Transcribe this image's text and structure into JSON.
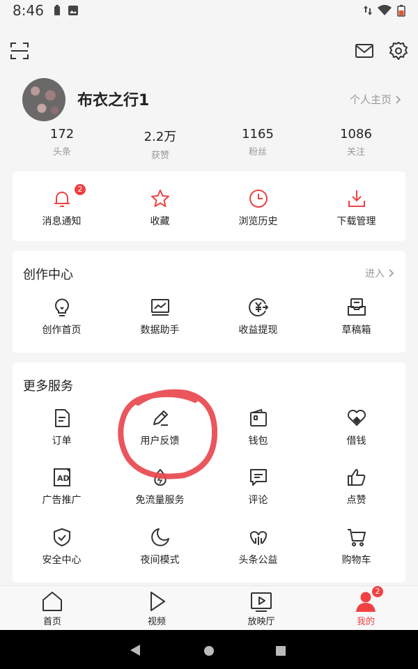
{
  "status_bar": {
    "time": "8:46"
  },
  "profile": {
    "username": "布衣之行1",
    "homepage_label": "个人主页"
  },
  "stats": [
    {
      "value": "172",
      "label": "头条"
    },
    {
      "value": "2.2万",
      "label": "获赞"
    },
    {
      "value": "1165",
      "label": "粉丝"
    },
    {
      "value": "1086",
      "label": "关注"
    }
  ],
  "quick_actions": [
    {
      "label": "消息通知",
      "icon": "bell-icon",
      "badge": "2"
    },
    {
      "label": "收藏",
      "icon": "star-icon"
    },
    {
      "label": "浏览历史",
      "icon": "clock-icon"
    },
    {
      "label": "下载管理",
      "icon": "download-icon"
    }
  ],
  "creation_center": {
    "title": "创作中心",
    "enter_label": "进入",
    "items": [
      {
        "label": "创作首页",
        "icon": "lightbulb-icon"
      },
      {
        "label": "数据助手",
        "icon": "chart-monitor-icon"
      },
      {
        "label": "收益提现",
        "icon": "yuan-coin-icon"
      },
      {
        "label": "草稿箱",
        "icon": "draft-box-icon"
      }
    ]
  },
  "more_services": {
    "title": "更多服务",
    "items": [
      {
        "label": "订单",
        "icon": "document-icon"
      },
      {
        "label": "用户反馈",
        "icon": "pen-icon"
      },
      {
        "label": "钱包",
        "icon": "wallet-icon"
      },
      {
        "label": "借钱",
        "icon": "loan-heart-icon"
      },
      {
        "label": "广告推广",
        "icon": "ad-icon"
      },
      {
        "label": "免流量服务",
        "icon": "data-drop-icon"
      },
      {
        "label": "评论",
        "icon": "comment-icon"
      },
      {
        "label": "点赞",
        "icon": "thumbs-up-icon"
      },
      {
        "label": "安全中心",
        "icon": "shield-icon"
      },
      {
        "label": "夜间模式",
        "icon": "moon-icon"
      },
      {
        "label": "头条公益",
        "icon": "charity-icon"
      },
      {
        "label": "购物车",
        "icon": "cart-icon"
      }
    ]
  },
  "tabbar": {
    "tabs": [
      {
        "label": "首页",
        "icon": "home-icon"
      },
      {
        "label": "视频",
        "icon": "play-icon"
      },
      {
        "label": "放映厅",
        "icon": "tv-icon"
      },
      {
        "label": "我的",
        "icon": "person-icon",
        "badge": "2",
        "active": true
      }
    ]
  },
  "colors": {
    "accent": "#f04142",
    "annotation": "#e8444a"
  }
}
